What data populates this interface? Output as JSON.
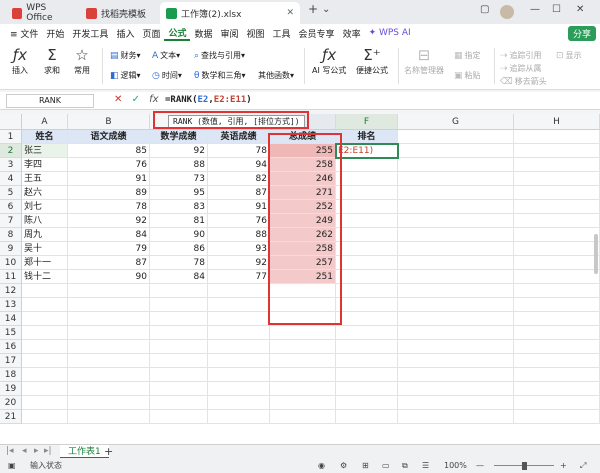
{
  "titlebar": {
    "tabs": [
      {
        "label": "WPS Office",
        "color": "#d9413a"
      },
      {
        "label": "找稻壳模板",
        "color": "#d9413a"
      },
      {
        "label": "工作簿(2).xlsx",
        "color": "#1a9b4d"
      }
    ],
    "new_tab": "+",
    "ai_label": "WPS AI"
  },
  "menu": {
    "items": [
      "≡ 文件",
      "开始",
      "开发工具",
      "插入",
      "页面",
      "公式",
      "数据",
      "审阅",
      "视图",
      "工具",
      "会员专享",
      "效率"
    ],
    "active": "公式",
    "ai": "✦ WPS AI",
    "share": "分享"
  },
  "ribbon": {
    "insert": "插入",
    "sum": "求和",
    "common": "常用",
    "finance": "财务",
    "logic": "逻辑",
    "text": "文本",
    "time": "时间",
    "lookup": "查找与引用",
    "math": "数学和三角",
    "other": "其他函数",
    "ai_formula": "AI 写公式",
    "easy": "便捷公式",
    "name_mgr": "名称管理器",
    "define": "指定",
    "paste": "粘贴",
    "trace_prec": "追踪引用",
    "trace_dep": "追踪从属",
    "remove": "移去箭头",
    "show": "显示"
  },
  "formulabar": {
    "namebox": "RANK",
    "fx": "fx",
    "formula_prefix": "=RANK(",
    "ref1": "E2",
    "comma": ",",
    "ref2": "E2:E11",
    "formula_suffix": ")"
  },
  "tooltip": "RANK (数值, 引用, [排位方式])",
  "columns": [
    "A",
    "B",
    "C",
    "D",
    "E",
    "F",
    "G",
    "H"
  ],
  "rows": [
    "1",
    "2",
    "3",
    "4",
    "5",
    "6",
    "7",
    "8",
    "9",
    "10",
    "11",
    "12",
    "13",
    "14",
    "15",
    "16",
    "17",
    "18",
    "19",
    "20",
    "21"
  ],
  "table": {
    "headers": [
      "姓名",
      "语文成绩",
      "数学成绩",
      "英语成绩",
      "总成绩",
      "排名"
    ],
    "data": [
      [
        "张三",
        "85",
        "92",
        "78",
        "255"
      ],
      [
        "李四",
        "76",
        "88",
        "94",
        "258"
      ],
      [
        "王五",
        "91",
        "73",
        "82",
        "246"
      ],
      [
        "赵六",
        "89",
        "95",
        "87",
        "271"
      ],
      [
        "刘七",
        "78",
        "83",
        "91",
        "252"
      ],
      [
        "陈八",
        "92",
        "81",
        "76",
        "249"
      ],
      [
        "周九",
        "84",
        "90",
        "88",
        "262"
      ],
      [
        "吴十",
        "79",
        "86",
        "93",
        "258"
      ],
      [
        "郑十一",
        "87",
        "78",
        "92",
        "257"
      ],
      [
        "钱十二",
        "90",
        "84",
        "77",
        "251"
      ]
    ],
    "f2_text": "E2:E11)"
  },
  "sheets": {
    "tab": "工作表1",
    "add": "+"
  },
  "status": {
    "text": "输入状态",
    "zoom": "100%"
  }
}
